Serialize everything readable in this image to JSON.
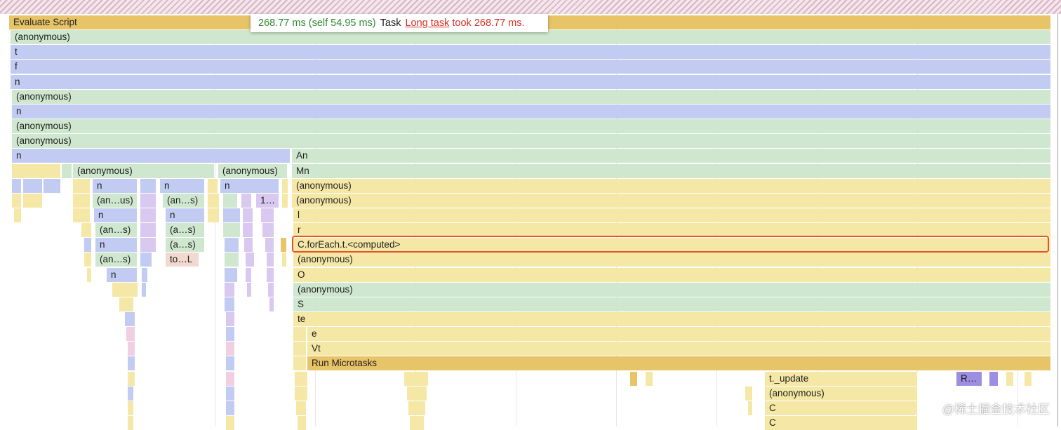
{
  "colors": {
    "yellow": "#f5e8a6",
    "gold": "#e8c468",
    "green": "#cfe7cf",
    "blue": "#c2cbf1",
    "purple": "#d9c8ef",
    "pink": "#f1cfe3",
    "peach": "#f2d9cf",
    "violet": "#9e8ee2"
  },
  "tooltip": {
    "duration": "268.77 ms (self 54.95 ms)",
    "task": "Task",
    "long_task": "Long task",
    "took": "took 268.77 ms."
  },
  "watermark": "@稀土掘金技术社区",
  "frames": [
    {
      "row": 0,
      "start": 13,
      "end": 1498,
      "color": "gold",
      "label": "Evaluate Script"
    },
    {
      "row": 1,
      "start": 15,
      "end": 1498,
      "color": "green",
      "label": "(anonymous)"
    },
    {
      "row": 2,
      "start": 15,
      "end": 1498,
      "color": "blue",
      "label": "t"
    },
    {
      "row": 3,
      "start": 15,
      "end": 1498,
      "color": "blue",
      "label": "f"
    },
    {
      "row": 4,
      "start": 15,
      "end": 1498,
      "color": "blue",
      "label": "n"
    },
    {
      "row": 5,
      "start": 17,
      "end": 1498,
      "color": "green",
      "label": "(anonymous)"
    },
    {
      "row": 6,
      "start": 17,
      "end": 1498,
      "color": "blue",
      "label": "n"
    },
    {
      "row": 7,
      "start": 17,
      "end": 1498,
      "color": "green",
      "label": "(anonymous)"
    },
    {
      "row": 8,
      "start": 17,
      "end": 1498,
      "color": "green",
      "label": "(anonymous)"
    },
    {
      "row": 9,
      "start": 17,
      "end": 414,
      "color": "blue",
      "label": "n"
    },
    {
      "row": 9,
      "start": 416,
      "end": 1498,
      "color": "green",
      "label": "An"
    },
    {
      "row": 10,
      "start": 104,
      "end": 306,
      "color": "green",
      "label": "(anonymous)"
    },
    {
      "row": 10,
      "start": 311,
      "end": 410,
      "color": "green",
      "label": "(anonymous)"
    },
    {
      "row": 10,
      "start": 416,
      "end": 1498,
      "color": "green",
      "label": "Mn"
    },
    {
      "row": 11,
      "start": 132,
      "end": 196,
      "color": "blue",
      "label": "n"
    },
    {
      "row": 11,
      "start": 228,
      "end": 292,
      "color": "blue",
      "label": "n"
    },
    {
      "row": 11,
      "start": 314,
      "end": 398,
      "color": "blue",
      "label": "n"
    },
    {
      "row": 11,
      "start": 416,
      "end": 1498,
      "color": "yellow",
      "label": "(anonymous)"
    },
    {
      "row": 12,
      "start": 132,
      "end": 196,
      "color": "green",
      "label": "(an…us)"
    },
    {
      "row": 12,
      "start": 232,
      "end": 292,
      "color": "green",
      "label": "(an…s)"
    },
    {
      "row": 12,
      "start": 365,
      "end": 398,
      "color": "purple",
      "label": "1…"
    },
    {
      "row": 12,
      "start": 416,
      "end": 1498,
      "color": "yellow",
      "label": "(anonymous)"
    },
    {
      "row": 13,
      "start": 134,
      "end": 196,
      "color": "blue",
      "label": "n"
    },
    {
      "row": 13,
      "start": 236,
      "end": 292,
      "color": "blue",
      "label": "n"
    },
    {
      "row": 13,
      "start": 418,
      "end": 1498,
      "color": "yellow",
      "label": "l"
    },
    {
      "row": 14,
      "start": 136,
      "end": 196,
      "color": "green",
      "label": "(an…s)"
    },
    {
      "row": 14,
      "start": 236,
      "end": 292,
      "color": "green",
      "label": "(a…s)"
    },
    {
      "row": 14,
      "start": 418,
      "end": 1498,
      "color": "yellow",
      "label": "r"
    },
    {
      "row": 15,
      "start": 136,
      "end": 196,
      "color": "blue",
      "label": "n"
    },
    {
      "row": 15,
      "start": 236,
      "end": 292,
      "color": "green",
      "label": "(a…s)"
    },
    {
      "row": 15,
      "start": 418,
      "end": 1498,
      "color": "yellow",
      "label": "C.forEach.t.<computed>"
    },
    {
      "row": 16,
      "start": 136,
      "end": 196,
      "color": "green",
      "label": "(an…s)"
    },
    {
      "row": 16,
      "start": 236,
      "end": 284,
      "color": "peach",
      "label": "to…L"
    },
    {
      "row": 16,
      "start": 418,
      "end": 1498,
      "color": "yellow",
      "label": "(anonymous)"
    },
    {
      "row": 17,
      "start": 152,
      "end": 196,
      "color": "blue",
      "label": "n"
    },
    {
      "row": 17,
      "start": 418,
      "end": 1498,
      "color": "yellow",
      "label": "O"
    },
    {
      "row": 18,
      "start": 418,
      "end": 1498,
      "color": "green",
      "label": "(anonymous)"
    },
    {
      "row": 19,
      "start": 418,
      "end": 1498,
      "color": "green",
      "label": "S"
    },
    {
      "row": 20,
      "start": 418,
      "end": 1498,
      "color": "yellow",
      "label": "te"
    },
    {
      "row": 21,
      "start": 438,
      "end": 1498,
      "color": "yellow",
      "label": "e"
    },
    {
      "row": 22,
      "start": 438,
      "end": 1498,
      "color": "yellow",
      "label": "Vt"
    },
    {
      "row": 23,
      "start": 438,
      "end": 1498,
      "color": "gold",
      "label": "Run Microtasks"
    },
    {
      "row": 24,
      "start": 1090,
      "end": 1308,
      "color": "yellow",
      "label": "t._update"
    },
    {
      "row": 24,
      "start": 1363,
      "end": 1400,
      "color": "violet",
      "label": "R…"
    },
    {
      "row": 25,
      "start": 1090,
      "end": 1308,
      "color": "yellow",
      "label": "(anonymous)"
    },
    {
      "row": 26,
      "start": 1090,
      "end": 1308,
      "color": "yellow",
      "label": "C"
    },
    {
      "row": 27,
      "start": 1090,
      "end": 1308,
      "color": "yellow",
      "label": "C"
    }
  ],
  "slivers": [
    {
      "row": 10,
      "start": 17,
      "end": 86,
      "color": "yellow"
    },
    {
      "row": 10,
      "start": 88,
      "end": 102,
      "color": "green"
    },
    {
      "row": 11,
      "start": 17,
      "end": 30,
      "color": "blue"
    },
    {
      "row": 11,
      "start": 33,
      "end": 60,
      "color": "blue"
    },
    {
      "row": 11,
      "start": 62,
      "end": 86,
      "color": "blue"
    },
    {
      "row": 11,
      "start": 104,
      "end": 128,
      "color": "yellow"
    },
    {
      "row": 11,
      "start": 200,
      "end": 222,
      "color": "blue"
    },
    {
      "row": 11,
      "start": 296,
      "end": 310,
      "color": "yellow"
    },
    {
      "row": 11,
      "start": 402,
      "end": 410,
      "color": "yellow"
    },
    {
      "row": 12,
      "start": 17,
      "end": 30,
      "color": "yellow"
    },
    {
      "row": 12,
      "start": 33,
      "end": 60,
      "color": "yellow"
    },
    {
      "row": 12,
      "start": 104,
      "end": 128,
      "color": "yellow"
    },
    {
      "row": 12,
      "start": 200,
      "end": 222,
      "color": "purple"
    },
    {
      "row": 12,
      "start": 296,
      "end": 312,
      "color": "yellow"
    },
    {
      "row": 12,
      "start": 318,
      "end": 338,
      "color": "green"
    },
    {
      "row": 12,
      "start": 344,
      "end": 358,
      "color": "purple"
    },
    {
      "row": 12,
      "start": 402,
      "end": 410,
      "color": "yellow"
    },
    {
      "row": 13,
      "start": 20,
      "end": 30,
      "color": "yellow"
    },
    {
      "row": 13,
      "start": 104,
      "end": 128,
      "color": "yellow"
    },
    {
      "row": 13,
      "start": 200,
      "end": 222,
      "color": "purple"
    },
    {
      "row": 13,
      "start": 296,
      "end": 312,
      "color": "yellow"
    },
    {
      "row": 13,
      "start": 318,
      "end": 342,
      "color": "blue"
    },
    {
      "row": 13,
      "start": 346,
      "end": 360,
      "color": "purple"
    },
    {
      "row": 13,
      "start": 372,
      "end": 390,
      "color": "purple"
    },
    {
      "row": 14,
      "start": 116,
      "end": 130,
      "color": "yellow"
    },
    {
      "row": 14,
      "start": 200,
      "end": 222,
      "color": "purple"
    },
    {
      "row": 14,
      "start": 318,
      "end": 342,
      "color": "green"
    },
    {
      "row": 14,
      "start": 346,
      "end": 360,
      "color": "purple"
    },
    {
      "row": 14,
      "start": 374,
      "end": 390,
      "color": "purple"
    },
    {
      "row": 15,
      "start": 120,
      "end": 130,
      "color": "blue"
    },
    {
      "row": 15,
      "start": 200,
      "end": 222,
      "color": "purple"
    },
    {
      "row": 15,
      "start": 320,
      "end": 340,
      "color": "blue"
    },
    {
      "row": 15,
      "start": 348,
      "end": 360,
      "color": "purple"
    },
    {
      "row": 15,
      "start": 378,
      "end": 390,
      "color": "purple"
    },
    {
      "row": 15,
      "start": 400,
      "end": 408,
      "color": "gold"
    },
    {
      "row": 16,
      "start": 120,
      "end": 130,
      "color": "yellow"
    },
    {
      "row": 16,
      "start": 200,
      "end": 216,
      "color": "blue"
    },
    {
      "row": 16,
      "start": 320,
      "end": 340,
      "color": "green"
    },
    {
      "row": 16,
      "start": 350,
      "end": 362,
      "color": "purple"
    },
    {
      "row": 16,
      "start": 380,
      "end": 390,
      "color": "purple"
    },
    {
      "row": 16,
      "start": 402,
      "end": 408,
      "color": "yellow"
    },
    {
      "row": 17,
      "start": 124,
      "end": 130,
      "color": "yellow"
    },
    {
      "row": 17,
      "start": 202,
      "end": 210,
      "color": "blue"
    },
    {
      "row": 17,
      "start": 320,
      "end": 338,
      "color": "blue"
    },
    {
      "row": 17,
      "start": 350,
      "end": 358,
      "color": "purple"
    },
    {
      "row": 17,
      "start": 380,
      "end": 390,
      "color": "purple"
    },
    {
      "row": 18,
      "start": 160,
      "end": 196,
      "color": "yellow"
    },
    {
      "row": 18,
      "start": 202,
      "end": 208,
      "color": "blue"
    },
    {
      "row": 18,
      "start": 320,
      "end": 334,
      "color": "purple"
    },
    {
      "row": 18,
      "start": 352,
      "end": 358,
      "color": "purple"
    },
    {
      "row": 18,
      "start": 382,
      "end": 390,
      "color": "purple"
    },
    {
      "row": 19,
      "start": 170,
      "end": 190,
      "color": "yellow"
    },
    {
      "row": 19,
      "start": 320,
      "end": 334,
      "color": "blue"
    },
    {
      "row": 19,
      "start": 384,
      "end": 390,
      "color": "purple"
    },
    {
      "row": 20,
      "start": 178,
      "end": 192,
      "color": "blue"
    },
    {
      "row": 20,
      "start": 322,
      "end": 334,
      "color": "purple"
    },
    {
      "row": 21,
      "start": 180,
      "end": 192,
      "color": "pink"
    },
    {
      "row": 21,
      "start": 322,
      "end": 334,
      "color": "blue"
    },
    {
      "row": 21,
      "start": 418,
      "end": 436,
      "color": "yellow"
    },
    {
      "row": 22,
      "start": 182,
      "end": 192,
      "color": "pink"
    },
    {
      "row": 22,
      "start": 322,
      "end": 334,
      "color": "pink"
    },
    {
      "row": 22,
      "start": 418,
      "end": 436,
      "color": "yellow"
    },
    {
      "row": 23,
      "start": 182,
      "end": 192,
      "color": "blue"
    },
    {
      "row": 23,
      "start": 322,
      "end": 334,
      "color": "blue"
    },
    {
      "row": 23,
      "start": 418,
      "end": 436,
      "color": "yellow"
    },
    {
      "row": 24,
      "start": 182,
      "end": 192,
      "color": "yellow"
    },
    {
      "row": 24,
      "start": 322,
      "end": 334,
      "color": "pink"
    },
    {
      "row": 24,
      "start": 420,
      "end": 438,
      "color": "yellow"
    },
    {
      "row": 24,
      "start": 576,
      "end": 610,
      "color": "yellow"
    },
    {
      "row": 24,
      "start": 898,
      "end": 908,
      "color": "gold"
    },
    {
      "row": 24,
      "start": 920,
      "end": 930,
      "color": "yellow"
    },
    {
      "row": 24,
      "start": 1410,
      "end": 1422,
      "color": "violet"
    },
    {
      "row": 24,
      "start": 1434,
      "end": 1444,
      "color": "yellow"
    },
    {
      "row": 24,
      "start": 1460,
      "end": 1470,
      "color": "yellow"
    },
    {
      "row": 25,
      "start": 182,
      "end": 190,
      "color": "blue"
    },
    {
      "row": 25,
      "start": 322,
      "end": 334,
      "color": "blue"
    },
    {
      "row": 25,
      "start": 420,
      "end": 438,
      "color": "yellow"
    },
    {
      "row": 25,
      "start": 580,
      "end": 608,
      "color": "yellow"
    },
    {
      "row": 25,
      "start": 1062,
      "end": 1072,
      "color": "yellow"
    },
    {
      "row": 26,
      "start": 182,
      "end": 190,
      "color": "yellow"
    },
    {
      "row": 26,
      "start": 322,
      "end": 334,
      "color": "blue"
    },
    {
      "row": 26,
      "start": 422,
      "end": 436,
      "color": "yellow"
    },
    {
      "row": 26,
      "start": 582,
      "end": 606,
      "color": "yellow"
    },
    {
      "row": 26,
      "start": 1066,
      "end": 1072,
      "color": "yellow"
    },
    {
      "row": 27,
      "start": 182,
      "end": 190,
      "color": "yellow"
    },
    {
      "row": 27,
      "start": 322,
      "end": 334,
      "color": "yellow"
    },
    {
      "row": 27,
      "start": 424,
      "end": 436,
      "color": "yellow"
    },
    {
      "row": 27,
      "start": 584,
      "end": 604,
      "color": "yellow"
    }
  ]
}
